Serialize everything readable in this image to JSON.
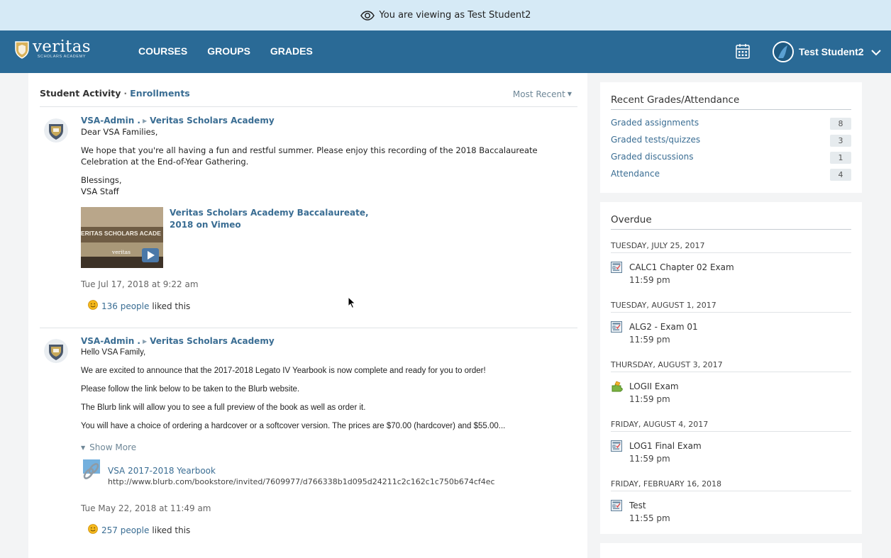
{
  "viewas": {
    "text": "You are viewing as Test Student2"
  },
  "nav": {
    "logo_text": "veritas",
    "logo_sub": "SCHOLARS ACADEMY",
    "links": [
      "COURSES",
      "GROUPS",
      "GRADES"
    ],
    "user_name": "Test Student2"
  },
  "activity": {
    "title": "Student Activity",
    "separator": "·",
    "enrollments": "Enrollments",
    "sort": "Most Recent"
  },
  "posts": [
    {
      "author": "VSA-Admin .",
      "group": "Veritas Scholars Academy",
      "greeting": "Dear VSA Families,",
      "paragraphs": [
        "We hope that you're all having a fun and restful summer. Please enjoy this recording of the 2018 Baccalaureate Celebration at the End-of-Year Gathering."
      ],
      "signoff_1": "Blessings,",
      "signoff_2": "VSA Staff",
      "video_title": "Veritas Scholars Academy Baccalaureate, 2018 on Vimeo",
      "thumb_caption": "ERITAS SCHOLARS ACADE",
      "thumb_logo": "veritas",
      "timestamp": "Tue Jul 17, 2018 at 9:22 am",
      "likes_count": "136 people",
      "likes_suffix": "liked this"
    },
    {
      "author": "VSA-Admin .",
      "group": "Veritas Scholars Academy",
      "greeting": "Hello VSA Family,",
      "paragraphs": [
        "We are excited to announce that the 2017-2018 Legato IV Yearbook is now complete and ready for you to order!",
        "Please follow the link below to be taken to the Blurb website.",
        "The Blurb link will allow you to see a full preview of the book as well as order it.",
        "You will have a choice of ordering a hardcover or a softcover version. The prices are $70.00 (hardcover) and $55.00..."
      ],
      "show_more": "Show More",
      "link_title": "VSA 2017-2018 Yearbook",
      "link_url": "http://www.blurb.com/bookstore/invited/7609977/d766338b1d095d24211c2c162c1c750b674cf4ec",
      "timestamp": "Tue May 22, 2018 at 11:49 am",
      "likes_count": "257 people",
      "likes_suffix": "liked this"
    }
  ],
  "recent": {
    "title": "Recent Grades/Attendance",
    "rows": [
      {
        "label": "Graded assignments",
        "count": "8"
      },
      {
        "label": "Graded tests/quizzes",
        "count": "3"
      },
      {
        "label": "Graded discussions",
        "count": "1"
      },
      {
        "label": "Attendance",
        "count": "4"
      }
    ]
  },
  "overdue": {
    "title": "Overdue",
    "groups": [
      {
        "date": "TUESDAY, JULY 25, 2017",
        "item": "CALC1 Chapter 02 Exam",
        "time": "11:59 pm",
        "icon": "quiz-icon"
      },
      {
        "date": "TUESDAY, AUGUST 1, 2017",
        "item": "ALG2 - Exam 01",
        "time": "11:59 pm",
        "icon": "quiz-icon"
      },
      {
        "date": "THURSDAY, AUGUST 3, 2017",
        "item": "LOGII Exam",
        "time": "11:59 pm",
        "icon": "puzzle-icon"
      },
      {
        "date": "FRIDAY, AUGUST 4, 2017",
        "item": "LOG1 Final Exam",
        "time": "11:59 pm",
        "icon": "quiz-icon"
      },
      {
        "date": "FRIDAY, FEBRUARY 16, 2018",
        "item": "Test",
        "time": "11:55 pm",
        "icon": "quiz-icon"
      }
    ]
  },
  "colors": {
    "nav": "#2a6a96",
    "banner": "#d6eaf6",
    "link": "#3a6d93",
    "background": "#f3f4f5"
  }
}
